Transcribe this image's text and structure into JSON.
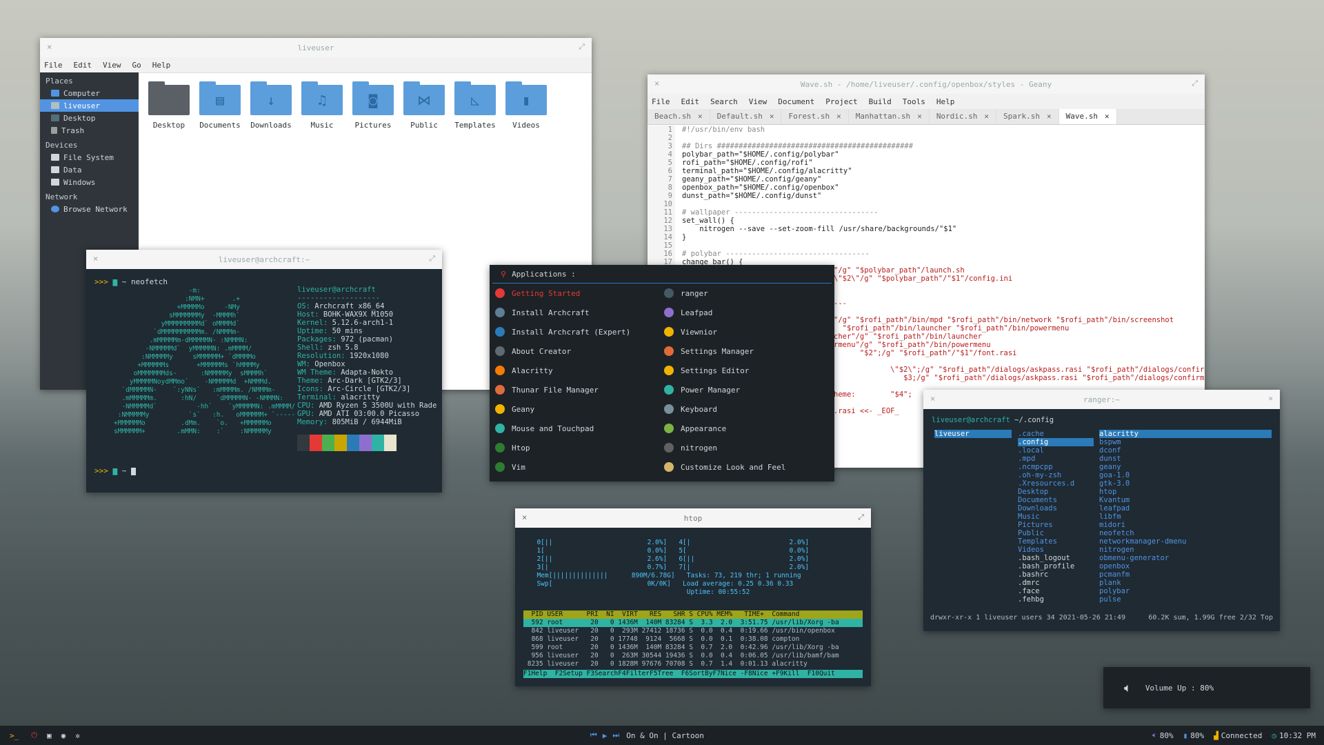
{
  "file_manager": {
    "title": "liveuser",
    "menu": [
      "File",
      "Edit",
      "View",
      "Go",
      "Help"
    ],
    "places_header": "Places",
    "places": [
      "Computer",
      "liveuser",
      "Desktop",
      "Trash"
    ],
    "devices_header": "Devices",
    "devices": [
      "File System",
      "Data",
      "Windows"
    ],
    "network_header": "Network",
    "network": [
      "Browse Network"
    ],
    "folders": [
      "Desktop",
      "Documents",
      "Downloads",
      "Music",
      "Pictures",
      "Public",
      "Templates",
      "Videos"
    ]
  },
  "geany": {
    "title": "Wave.sh - /home/liveuser/.config/openbox/styles - Geany",
    "menu": [
      "File",
      "Edit",
      "Search",
      "View",
      "Document",
      "Project",
      "Build",
      "Tools",
      "Help"
    ],
    "tabs": [
      "Beach.sh",
      "Default.sh",
      "Forest.sh",
      "Manhattan.sh",
      "Nordic.sh",
      "Spark.sh",
      "Wave.sh"
    ],
    "line_numbers": [
      "1",
      "2",
      "3",
      "4",
      "5",
      "6",
      "7",
      "8",
      "9",
      "10",
      "11",
      "12",
      "13",
      "14",
      "15",
      "16",
      "17"
    ],
    "code": [
      "#!/usr/bin/env bash",
      "",
      "## Dirs #############################################",
      "polybar_path=\"$HOME/.config/polybar\"",
      "rofi_path=\"$HOME/.config/rofi\"",
      "terminal_path=\"$HOME/.config/alacritty\"",
      "geany_path=\"$HOME/.config/geany\"",
      "openbox_path=\"$HOME/.config/openbox\"",
      "dunst_path=\"$HOME/.config/dunst\"",
      "",
      "# wallpaper ---------------------------------",
      "set_wall() {",
      "    nitrogen --save --set-zoom-fill /usr/share/backgrounds/\"$1\"",
      "}",
      "",
      "# polybar ---------------------------------",
      "change_bar() {"
    ],
    "code_tail": [
      "\"/g\" \"$polybar_path\"/launch.sh",
      "\\\"$2\\\"/g\" \"$polybar_path\"/\"$1\"/config.ini",
      "",
      "",
      "---",
      "",
      "\"/g\" \"$rofi_path\"/bin/mpd \"$rofi_path\"/bin/network \"$rofi_path\"/bin/screenshot",
      "  \"$rofi_path\"/bin/launcher \"$rofi_path\"/bin/powermenu",
      "cher\"/g\" \"$rofi_path\"/bin/launcher",
      "rmenu\"/g\" \"$rofi_path\"/bin/powermenu",
      "      \"$2\";/g\" \"$rofi_path\"/\"$1\"/font.rasi",
      "",
      "             \\\"$2\\\";/g\" \"$rofi_path\"/dialogs/askpass.rasi \"$rofi_path\"/dialogs/confirm.ra",
      "                $3;/g\" \"$rofi_path\"/dialogs/askpass.rasi \"$rofi_path\"/dialogs/confirm.ra",
      "",
      "heme:        \"$4\";",
      "",
      ".rasi <<- _EOF_"
    ]
  },
  "neofetch": {
    "title": "liveuser@archcraft:~",
    "prompt_cmd": "~ neofetch",
    "prompt_arrows": ">>>",
    "prompt_end": "~",
    "user_host": "liveuser@archcraft",
    "sep": "-------------------",
    "info": [
      {
        "k": "OS:",
        "v": " Archcraft x86_64"
      },
      {
        "k": "Host:",
        "v": " BOHK-WAX9X M1050"
      },
      {
        "k": "Kernel:",
        "v": " 5.12.6-arch1-1"
      },
      {
        "k": "Uptime:",
        "v": " 50 mins"
      },
      {
        "k": "Packages:",
        "v": " 972 (pacman)"
      },
      {
        "k": "Shell:",
        "v": " zsh 5.8"
      },
      {
        "k": "Resolution:",
        "v": " 1920x1080"
      },
      {
        "k": "WM:",
        "v": " Openbox"
      },
      {
        "k": "WM Theme:",
        "v": " Adapta-Nokto"
      },
      {
        "k": "Theme:",
        "v": " Arc-Dark [GTK2/3]"
      },
      {
        "k": "Icons:",
        "v": " Arc-Circle [GTK2/3]"
      },
      {
        "k": "Terminal:",
        "v": " alacritty"
      },
      {
        "k": "CPU:",
        "v": " AMD Ryzen 5 3500U with Rade"
      },
      {
        "k": "GPU:",
        "v": " AMD ATI 03:00.0 Picasso"
      },
      {
        "k": "Memory:",
        "v": " 805MiB / 6944MiB"
      }
    ],
    "logo": "                   -m:\n                  :NMN+       .+\n                +MMMMMo     -NMy\n              sMMMMMMMy  -MMMMh`\n            yMMMMMMMMMd` oMMMMd`\n          `dMMMMMMMMMMm. /NMMMm-\n         .mMMMMMm-dMMMMMN- :NMMMN:\n        -NMMMMMd`  yMMMMMN: .mMMMM/\n       :NMMMMMy     sMMMMMM+ `dMMMMo\n      +MMMMMMs       +MMMMMMs `hMMMMy\n     oMMMMMMMds-      :NMMMMMy  sMMMMh`\n    yMMMMMNoydMMmo`    -NMMMMMd  +NMMMd.\n  `dMMMMMN-    `:yNNs`   :mMMMMm. /NMMMm-\n  .mMMMMMm.      :hN/     `dMMMMMN- -NMMMN:\n  -NMMMMMd`          -hh`    `yMMMMMN: .mMMMM/\n :NMMMMMy          `s`   :h.   oMMMMMM+ `-----\n+MMMMMMo         .dMm.    `o.   +MMMMMMo\nsMMMMMM+        .mMMN:    :`    :NMMMMMy",
    "swatches": [
      "#33393e",
      "#e53935",
      "#4caf50",
      "#c9a500",
      "#2b7bb9",
      "#8e6fcf",
      "#2fb3a4",
      "#e8e4d0"
    ]
  },
  "rofi": {
    "title": "Applications :",
    "left": [
      "Getting Started",
      "Install Archcraft",
      "Install Archcraft (Expert)",
      "About Creator",
      "Alacritty",
      "Thunar File Manager",
      "Geany",
      "Mouse and Touchpad",
      "Htop",
      "Vim"
    ],
    "right": [
      "ranger",
      "Leafpad",
      "Viewnior",
      "Settings Manager",
      "Settings Editor",
      "Power Manager",
      "Keyboard",
      "Appearance",
      "nitrogen",
      "Customize Look and Feel"
    ],
    "left_colors": [
      "#e53935",
      "#5f7f95",
      "#2b7bb9",
      "#5f6b73",
      "#f57c00",
      "#e06c3a",
      "#f0b400",
      "#2fb3a4",
      "#2e7d32",
      "#2e7d32"
    ],
    "right_colors": [
      "#455a64",
      "#8e6fcf",
      "#f0b400",
      "#e06c3a",
      "#f0b400",
      "#2fb3a4",
      "#78909c",
      "#7cb342",
      "#616161",
      "#d7b46a"
    ],
    "selected_color": "#e53935"
  },
  "htop": {
    "title": "htop",
    "cpu_lines": [
      "  0[||                        2.0%]   4[|                         2.0%]",
      "  1[                          0.0%]   5[                          0.0%]",
      "  2[||                        2.6%]   6[||                        2.0%]",
      "  3[|                         0.7%]   7[|                         2.0%]",
      "  Mem[||||||||||||||      890M/6.78G]   Tasks: 73, 219 thr; 1 running",
      "  Swp[                        0K/0K]   Load average: 0.25 0.36 0.33",
      "                                        Uptime: 00:55:52"
    ],
    "header": "  PID USER      PRI  NI  VIRT   RES   SHR S CPU% MEM%   TIME+  Command",
    "procs": [
      "  592 root       20   0 1436M  140M 83284 S  3.3  2.0  3:51.75 /usr/lib/Xorg -ba",
      "  842 liveuser   20   0  293M 27412 18736 S  0.0  0.4  0:19.66 /usr/bin/openbox",
      "  868 liveuser   20   0 17748  9124  5668 S  0.0  0.1  0:38.08 compton",
      "  599 root       20   0 1436M  140M 83284 S  0.7  2.0  0:42.96 /usr/lib/Xorg -ba",
      "  956 liveuser   20   0  263M 30544 19436 S  0.0  0.4  0:06.05 /usr/lib/bamf/bam",
      " 8235 liveuser   20   0 1828M 97676 70708 S  0.7  1.4  0:01.13 alacritty"
    ],
    "footer": "F1Help  F2Setup F3SearchF4FilterF5Tree  F6SortByF7Nice -F8Nice +F9Kill  F10Quit"
  },
  "ranger": {
    "title": "ranger:~",
    "path_user": "liveuser@archcraft",
    "path": " ~/.config",
    "col1": [
      "liveuser"
    ],
    "col2": [
      ".cache",
      ".config",
      ".local",
      ".mpd",
      ".ncmpcpp",
      ".oh-my-zsh",
      ".Xresources.d",
      "Desktop",
      "Documents",
      "Downloads",
      "Music",
      "Pictures",
      "Public",
      "Templates",
      "Videos",
      ".bash_logout",
      ".bash_profile",
      ".bashrc",
      ".dmrc",
      ".face",
      ".fehbg"
    ],
    "col3": [
      "alacritty",
      "bspwm",
      "dconf",
      "dunst",
      "geany",
      "goa-1.0",
      "gtk-3.0",
      "htop",
      "Kvantum",
      "leafpad",
      "libfm",
      "midori",
      "neofetch",
      "networkmanager-dmenu",
      "nitrogen",
      "obmenu-generator",
      "openbox",
      "pcmanfm",
      "plank",
      "polybar",
      "pulse"
    ],
    "status_left": "drwxr-xr-x 1 liveuser users 34 2021-05-26 21:49",
    "status_right": "60.2K sum, 1.99G free  2/32  Top"
  },
  "volume": {
    "text": "Volume Up : 80%"
  },
  "panel": {
    "left_icons": [
      "terminal-icon",
      "power-icon",
      "window-icon",
      "camera-icon",
      "settings-icon"
    ],
    "music": "On & On | Cartoon",
    "volume": "80%",
    "battery": "80%",
    "network": "Connected",
    "clock": "10:32 PM"
  }
}
